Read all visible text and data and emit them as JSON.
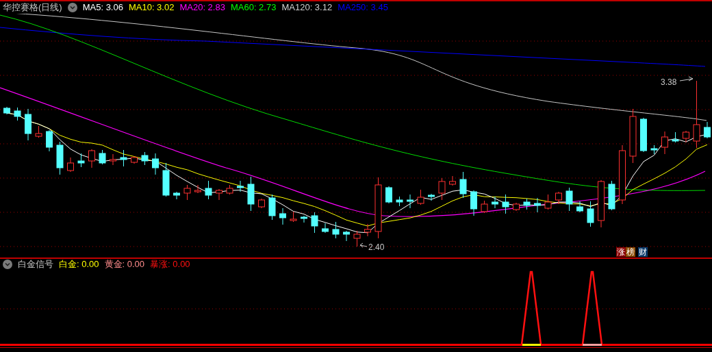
{
  "main_panel": {
    "title": "华控赛格(日线)",
    "indicators": [
      {
        "text": "MA5: 3.06",
        "color": "#ffffff"
      },
      {
        "text": "MA10: 3.02",
        "color": "#ffff00"
      },
      {
        "text": "MA20: 2.83",
        "color": "#ff00ff"
      },
      {
        "text": "MA60: 2.73",
        "color": "#00ff00"
      },
      {
        "text": "MA120: 3.12",
        "color": "#d0d0d0"
      },
      {
        "text": "MA250: 3.45",
        "color": "#0000ff"
      }
    ],
    "high_label": "3.38",
    "low_label": "2.40",
    "badges": [
      {
        "text": "涨",
        "color": "#8b0000"
      },
      {
        "text": "榜",
        "color": "#8b4a00"
      },
      {
        "text": "财",
        "color": "#0a3a6a"
      }
    ]
  },
  "signal_panel": {
    "title": "白金信号",
    "indicators": [
      {
        "text": "白金: 0.00",
        "color": "#ffff00"
      },
      {
        "text": "黄金: 0.00",
        "color": "#ff8c8c"
      },
      {
        "text": "暴涨: 0.00",
        "color": "#ff1010"
      }
    ]
  }
}
